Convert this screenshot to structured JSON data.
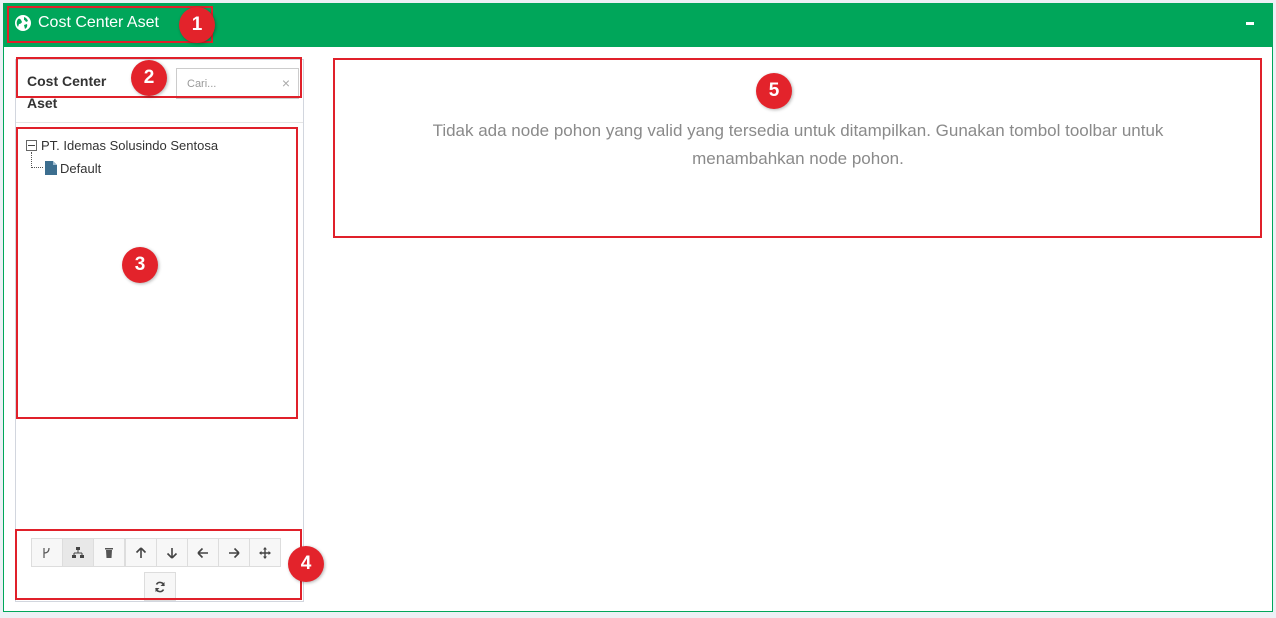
{
  "header": {
    "title": "Cost Center Aset",
    "color": "#00a65a"
  },
  "sidebar": {
    "title": "Cost Center Aset",
    "search": {
      "placeholder": "Cari...",
      "value": "",
      "clear_glyph": "×"
    },
    "tree": {
      "root": {
        "label": "PT. Idemas Solusindo Sentosa",
        "expanded": true
      },
      "children": [
        {
          "label": "Default",
          "icon": "file-icon"
        }
      ]
    },
    "toolbar": {
      "buttons": [
        "branch-icon",
        "sitemap-icon",
        "trash-icon",
        "arrow-up-icon",
        "arrow-down-icon",
        "arrow-left-icon",
        "arrow-right-icon",
        "move-icon"
      ],
      "refresh": "refresh-icon"
    }
  },
  "main": {
    "message": "Tidak ada node pohon yang valid yang tersedia untuk ditampilkan. Gunakan tombol toolbar untuk menambahkan node pohon."
  },
  "annotations": {
    "color": "#e3232b",
    "labels": [
      "1",
      "2",
      "3",
      "4",
      "5"
    ]
  }
}
